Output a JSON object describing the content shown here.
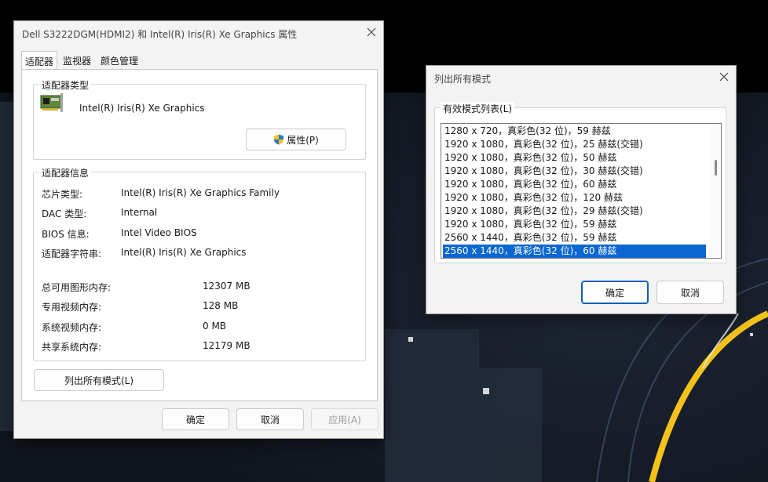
{
  "props_window": {
    "title": "Dell S3222DGM(HDMI2) 和 Intel(R) Iris(R) Xe Graphics 属性",
    "tabs": [
      {
        "label": "适配器",
        "active": true
      },
      {
        "label": "监视器",
        "active": false
      },
      {
        "label": "颜色管理",
        "active": false
      }
    ],
    "adapter_type": {
      "group_label": "适配器类型",
      "name": "Intel(R) Iris(R) Xe Graphics",
      "properties_button": "属性(P)"
    },
    "adapter_info": {
      "group_label": "适配器信息",
      "rows": [
        {
          "label": "芯片类型:",
          "value": "Intel(R) Iris(R) Xe Graphics Family"
        },
        {
          "label": "DAC 类型:",
          "value": "Internal"
        },
        {
          "label": "BIOS 信息:",
          "value": "Intel Video BIOS"
        },
        {
          "label": "适配器字符串:",
          "value": "Intel(R) Iris(R) Xe Graphics"
        }
      ],
      "memory_rows": [
        {
          "label": "总可用图形内存:",
          "value": "12307 MB"
        },
        {
          "label": "专用视频内存:",
          "value": "128 MB"
        },
        {
          "label": "系统视频内存:",
          "value": "0 MB"
        },
        {
          "label": "共享系统内存:",
          "value": "12179 MB"
        }
      ]
    },
    "list_modes_button": "列出所有模式(L)",
    "buttons": {
      "ok": "确定",
      "cancel": "取消",
      "apply": "应用(A)"
    }
  },
  "modes_window": {
    "title": "列出所有模式",
    "group_label": "有效模式列表(L)",
    "modes": [
      "1280 x 720，真彩色(32 位)，59 赫兹",
      "1920 x 1080，真彩色(32 位)，25 赫兹(交错)",
      "1920 x 1080，真彩色(32 位)，50 赫兹",
      "1920 x 1080，真彩色(32 位)，30 赫兹(交错)",
      "1920 x 1080，真彩色(32 位)，60 赫兹",
      "1920 x 1080，真彩色(32 位)，120 赫兹",
      "1920 x 1080，真彩色(32 位)，29 赫兹(交错)",
      "1920 x 1080，真彩色(32 位)，59 赫兹",
      "2560 x 1440，真彩色(32 位)，59 赫兹",
      "2560 x 1440，真彩色(32 位)，60 赫兹"
    ],
    "selected_index": 9,
    "buttons": {
      "ok": "确定",
      "cancel": "取消"
    }
  },
  "colors": {
    "accent": "#0a67d2",
    "window_bg": "#f3f3f3",
    "wallpaper_ring": "#f2c21b"
  }
}
